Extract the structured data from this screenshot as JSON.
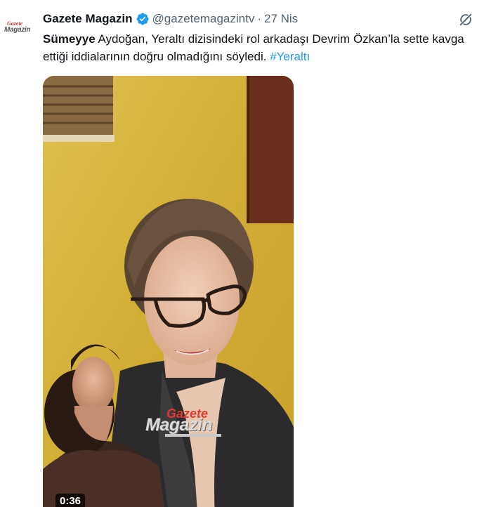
{
  "tweet": {
    "avatar": {
      "logo_line1": "Gazete",
      "logo_line2": "Magazin",
      "icon": "account-avatar-logo"
    },
    "author": {
      "display_name": "Gazete Magazin",
      "verified_icon": "verified-badge-icon",
      "handle": "@gazetemagazintv",
      "separator": "·",
      "date": "27 Nis"
    },
    "grok_icon": "grok-icon",
    "text": {
      "bold_part": "Sümeyye",
      "body": " Aydoğan, Yeraltı dizisindeki rol arkadaşı Devrim Özkan’la sette kavga ettiği iddialarının doğru olmadığını söyledi. ",
      "hashtag": "#Yeraltı"
    },
    "media": {
      "watermark_line1": "Gazete",
      "watermark_line2": "Magazin",
      "duration": "0:36"
    }
  },
  "colors": {
    "accent": "#1d9bf0",
    "text_primary": "#0f1419",
    "text_secondary": "#536471",
    "verified": "#1d9bf0",
    "wall": "#d5b33a"
  }
}
